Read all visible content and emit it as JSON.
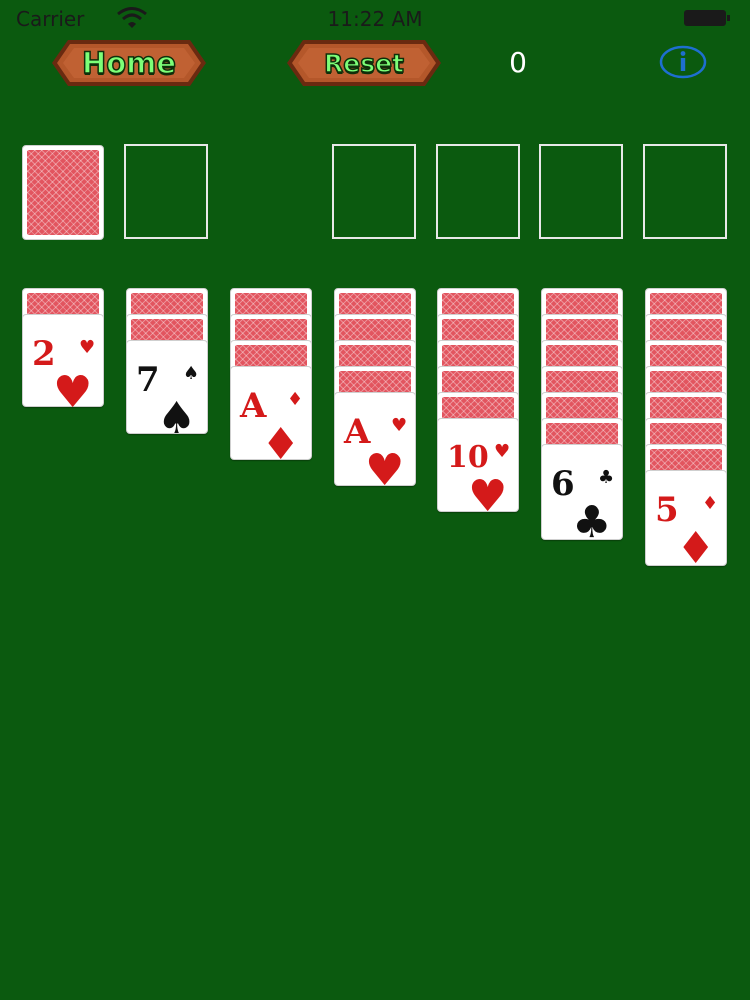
{
  "status_bar": {
    "carrier": "Carrier",
    "time": "11:22 AM"
  },
  "toolbar": {
    "home_label": "Home",
    "reset_label": "Reset",
    "score": "0",
    "info_icon": "info-icon"
  },
  "colors": {
    "felt": "#0b5a0f",
    "red_suit": "#d41a1a",
    "black_suit": "#111111",
    "button_text": "#7dff78",
    "wood": "#b4572a"
  },
  "stock": {
    "face_down": true
  },
  "waste": {
    "empty": true
  },
  "foundations": [
    {
      "empty": true
    },
    {
      "empty": true
    },
    {
      "empty": true
    },
    {
      "empty": true
    }
  ],
  "tableau": [
    {
      "face_down": 1,
      "top": {
        "rank": "2",
        "suit": "♥",
        "color": "red"
      }
    },
    {
      "face_down": 2,
      "top": {
        "rank": "7",
        "suit": "♠",
        "color": "black"
      }
    },
    {
      "face_down": 3,
      "top": {
        "rank": "A",
        "suit": "♦",
        "color": "red"
      }
    },
    {
      "face_down": 4,
      "top": {
        "rank": "A",
        "suit": "♥",
        "color": "red"
      }
    },
    {
      "face_down": 5,
      "top": {
        "rank": "10",
        "suit": "♥",
        "color": "red"
      }
    },
    {
      "face_down": 6,
      "top": {
        "rank": "6",
        "suit": "♣",
        "color": "black"
      }
    },
    {
      "face_down": 7,
      "top": {
        "rank": "5",
        "suit": "♦",
        "color": "red"
      }
    }
  ]
}
